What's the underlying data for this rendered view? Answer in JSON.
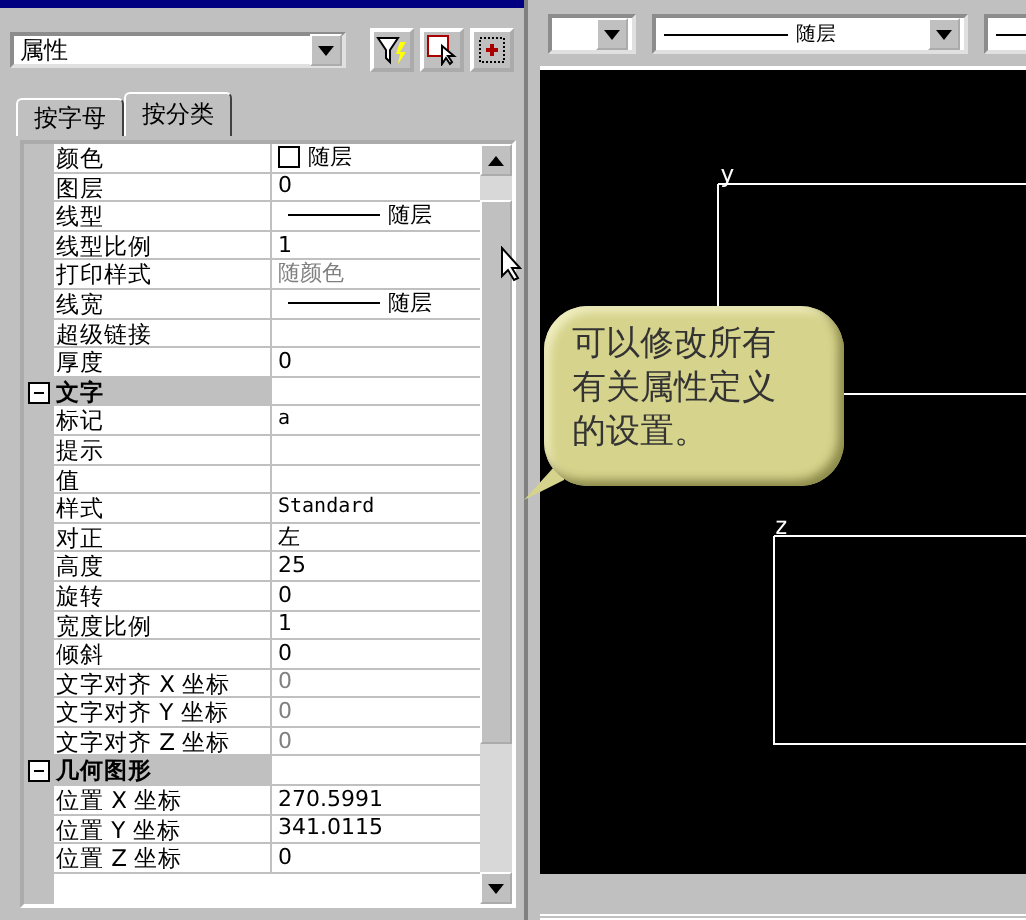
{
  "panel": {
    "dropdown": {
      "value": "属性"
    },
    "tabs": [
      {
        "label": "按字母",
        "selected": false
      },
      {
        "label": "按分类",
        "selected": true
      }
    ],
    "rows": [
      {
        "kind": "color",
        "name": "颜色",
        "value": "随层",
        "disabled": false
      },
      {
        "kind": "text",
        "name": "图层",
        "value": "0",
        "disabled": false
      },
      {
        "kind": "line",
        "name": "线型",
        "value": "随层",
        "disabled": false
      },
      {
        "kind": "text",
        "name": "线型比例",
        "value": "1",
        "disabled": false
      },
      {
        "kind": "text",
        "name": "打印样式",
        "value": "随颜色",
        "disabled": true
      },
      {
        "kind": "line",
        "name": "线宽",
        "value": "随层",
        "disabled": false
      },
      {
        "kind": "text",
        "name": "超级链接"
      },
      {
        "kind": "text",
        "name": "厚度",
        "value": "0",
        "disabled": false
      },
      {
        "kind": "category",
        "name": "文字",
        "expanded": true
      },
      {
        "kind": "mono",
        "name": "标记",
        "value": "a",
        "disabled": false
      },
      {
        "kind": "text",
        "name": "提示"
      },
      {
        "kind": "text",
        "name": "值"
      },
      {
        "kind": "mono",
        "name": "样式",
        "value": "Standard",
        "disabled": false
      },
      {
        "kind": "text",
        "name": "对正",
        "value": "左",
        "disabled": false
      },
      {
        "kind": "text",
        "name": "高度",
        "value": "25",
        "disabled": false
      },
      {
        "kind": "text",
        "name": "旋转",
        "value": "0",
        "disabled": false
      },
      {
        "kind": "text",
        "name": "宽度比例",
        "value": "1",
        "disabled": false
      },
      {
        "kind": "text",
        "name": "倾斜",
        "value": "0",
        "disabled": false
      },
      {
        "kind": "text",
        "name": "文字对齐 X 坐标",
        "value": "0",
        "disabled": true
      },
      {
        "kind": "text",
        "name": "文字对齐 Y 坐标",
        "value": "0",
        "disabled": true
      },
      {
        "kind": "text",
        "name": "文字对齐 Z 坐标",
        "value": "0",
        "disabled": true
      },
      {
        "kind": "category",
        "name": "几何图形",
        "expanded": true
      },
      {
        "kind": "text",
        "name": "位置 X 坐标",
        "value": "270.5991",
        "disabled": false
      },
      {
        "kind": "text",
        "name": "位置 Y 坐标",
        "value": "341.0115",
        "disabled": false
      },
      {
        "kind": "text",
        "name": "位置 Z 坐标",
        "value": "0",
        "disabled": false
      }
    ]
  },
  "toolbar": {
    "combos": [
      {
        "kind": "blank"
      },
      {
        "kind": "line",
        "value": "随层"
      },
      {
        "kind": "line_cut"
      }
    ]
  },
  "canvas": {
    "labels": [
      "y",
      "z"
    ]
  },
  "callout": {
    "lines": [
      "可以修改所有",
      "有关属性定义",
      "的设置。"
    ]
  }
}
